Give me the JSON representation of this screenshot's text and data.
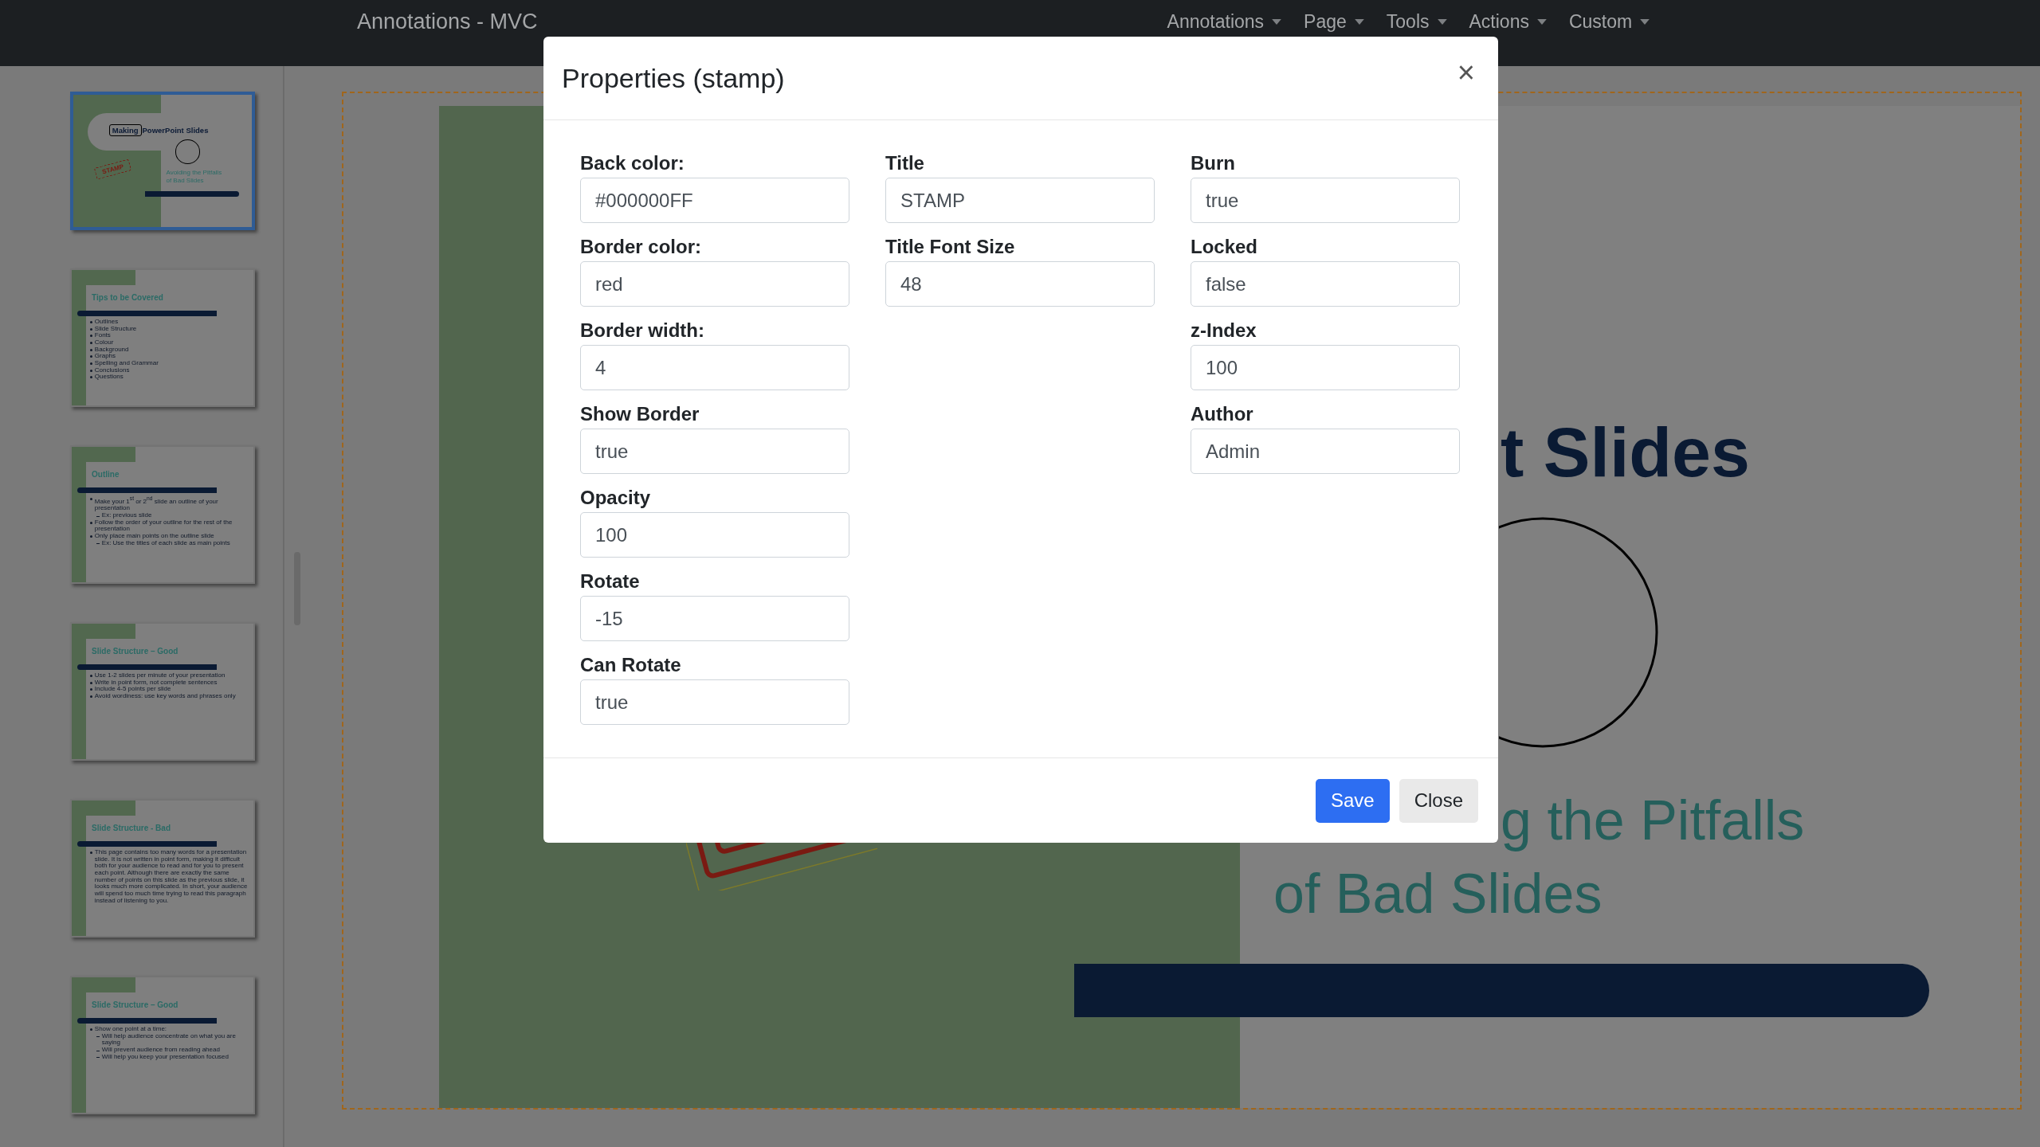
{
  "navbar": {
    "brand": "Annotations - MVC",
    "menus": [
      {
        "label": "Annotations"
      },
      {
        "label": "Page"
      },
      {
        "label": "Tools"
      },
      {
        "label": "Actions"
      },
      {
        "label": "Custom"
      }
    ]
  },
  "thumbnails": [
    {
      "kind": "title",
      "selected": true,
      "title_boxed_word": "Making",
      "title": "PowerPoint Slides",
      "stamp": "STAMP",
      "subtitle": [
        "Avoiding the Pitfalls",
        "of Bad Slides"
      ]
    },
    {
      "kind": "bullets",
      "selected": false,
      "title": "Tips to be Covered",
      "items": [
        {
          "text": "Outlines"
        },
        {
          "text": "Slide Structure"
        },
        {
          "text": "Fonts"
        },
        {
          "text": "Colour"
        },
        {
          "text": "Background"
        },
        {
          "text": "Graphs"
        },
        {
          "text": "Spelling and Grammar"
        },
        {
          "text": "Conclusions"
        },
        {
          "text": "Questions"
        }
      ]
    },
    {
      "kind": "bullets",
      "selected": false,
      "title": "Outline",
      "items": [
        {
          "text": "Make your 1$^{st}$ or 2$^{nd}$ slide an outline of your presentation",
          "children": [
            "Ex: previous slide"
          ]
        },
        {
          "text": "Follow the order of your outline for the rest of the presentation"
        },
        {
          "text": "Only place main points on the outline slide",
          "children": [
            "Ex: Use the titles of each slide as main points"
          ]
        }
      ]
    },
    {
      "kind": "bullets",
      "selected": false,
      "title": "Slide Structure – Good",
      "items": [
        {
          "text": "Use 1-2 slides per minute of your presentation"
        },
        {
          "text": "Write in point form, not complete sentences"
        },
        {
          "text": "Include 4-5 points per slide"
        },
        {
          "text": "Avoid wordiness: use key words and phrases only"
        }
      ]
    },
    {
      "kind": "bullets",
      "selected": false,
      "title": "Slide Structure - Bad",
      "items": [
        {
          "text": "This page contains too many words for a presentation slide.  It is not written in point form, making it difficult both for your audience to read and for you to present each point.  Although there are exactly the same number of points on this slide as the previous slide, it looks much more complicated.  In short, your audience will spend too much time trying to read this paragraph instead of listening to you."
        }
      ]
    },
    {
      "kind": "bullets",
      "selected": false,
      "title": "Slide Structure – Good",
      "items": [
        {
          "text": "Show one point at a time:",
          "children": [
            "Will help audience concentrate on what you are saying",
            "Will prevent audience from reading ahead",
            "Will help you keep your presentation focused"
          ]
        }
      ]
    }
  ],
  "canvas": {
    "title_fragment": "t Slides",
    "subtitle_lines": [
      "g the Pitfalls",
      "of Bad Slides"
    ]
  },
  "modal": {
    "title": "Properties (stamp)",
    "close": "×",
    "columns": [
      [
        {
          "label": "Back color:",
          "value": "#000000FF"
        },
        {
          "label": "Border color:",
          "value": "red"
        },
        {
          "label": "Border width:",
          "value": "4"
        },
        {
          "label": "Show Border",
          "value": "true"
        },
        {
          "label": "Opacity",
          "value": "100"
        },
        {
          "label": "Rotate",
          "value": "-15"
        },
        {
          "label": "Can Rotate",
          "value": "true"
        }
      ],
      [
        {
          "label": "Title",
          "value": "STAMP"
        },
        {
          "label": "Title Font Size",
          "value": "48"
        }
      ],
      [
        {
          "label": "Burn",
          "value": "true"
        },
        {
          "label": "Locked",
          "value": "false"
        },
        {
          "label": "z-Index",
          "value": "100"
        },
        {
          "label": "Author",
          "value": "Admin"
        }
      ]
    ],
    "buttons": [
      {
        "label": "Save",
        "kind": "primary"
      },
      {
        "label": "Close",
        "kind": "secondary"
      }
    ]
  }
}
